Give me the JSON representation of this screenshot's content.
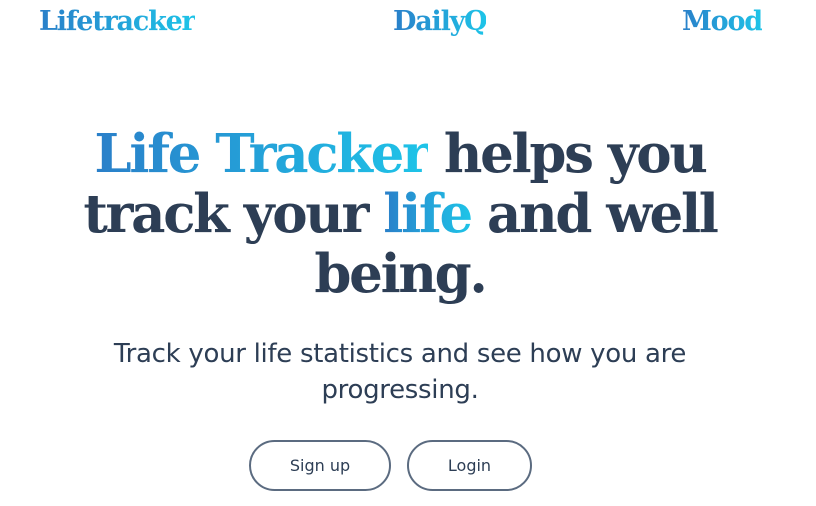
{
  "nav": {
    "items": [
      {
        "label": "Lifetracker"
      },
      {
        "label": "DailyQ"
      },
      {
        "label": "Mood"
      }
    ]
  },
  "hero": {
    "title": {
      "highlight_1": "Life Tracker",
      "text_1": " helps you track your ",
      "highlight_2": "life",
      "text_2": " and well being."
    },
    "subtitle": {
      "text_1": "Track your life ",
      "strong": "statistics",
      "text_2": " and see how you are progressing."
    }
  },
  "actions": {
    "signup_label": "Sign up",
    "login_label": "Login"
  },
  "colors": {
    "heading": "#2d3e55",
    "gradient_start": "#2a7fc9",
    "gradient_end": "#1ec4e8",
    "button_border": "#5b6b80"
  }
}
